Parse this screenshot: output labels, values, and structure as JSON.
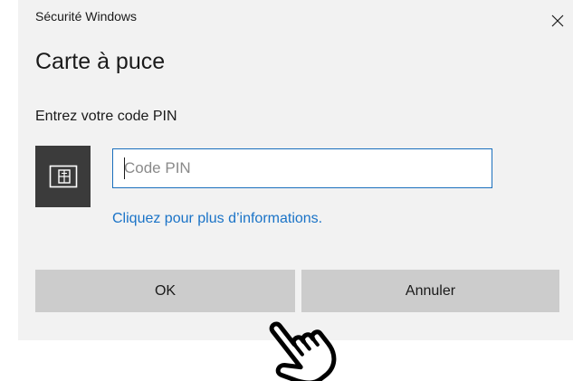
{
  "window": {
    "title": "Sécurité Windows",
    "close_icon": "close-icon"
  },
  "dialog": {
    "heading": "Carte à puce",
    "prompt": "Entrez votre code PIN",
    "card_icon": "smartcard-icon",
    "pin_input": {
      "placeholder": "Code PIN",
      "value": ""
    },
    "more_info_link": "Cliquez pour plus d’informations."
  },
  "buttons": {
    "ok": "OK",
    "cancel": "Annuler"
  },
  "colors": {
    "dialog_bg": "#f2f2f2",
    "button_bg": "#cccccc",
    "input_border": "#1a6fbd",
    "link": "#1a73c7",
    "card_tile": "#3b3b3b"
  },
  "cursor_icon": "hand-pointer-icon"
}
